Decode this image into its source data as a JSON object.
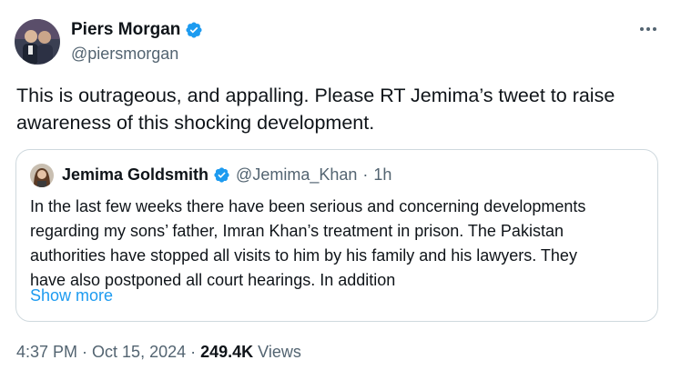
{
  "author": {
    "name": "Piers Morgan",
    "handle": "@piersmorgan"
  },
  "body_text": "This is outrageous, and appalling. Please RT Jemima’s tweet to raise awareness of this shocking development.",
  "quoted_tweet": {
    "name": "Jemima Goldsmith",
    "handle": "@Jemima_Khan",
    "separator": "·",
    "time": "1h",
    "text_lines": [
      "In the last few weeks there have been serious and concerning developments",
      "regarding my sons’ father, Imran Khan’s treatment in prison. The Pakistan",
      "authorities have stopped all visits to him by his family and his lawyers. They",
      "have also postponed all court hearings. In addition"
    ],
    "show_more_label": "Show more"
  },
  "meta": {
    "time": "4:37 PM",
    "separator1": "·",
    "date": "Oct 15, 2024",
    "separator2": "·",
    "views_count": "249.4K",
    "views_label": "Views"
  },
  "colors": {
    "verified_blue": "#1d9bf0",
    "link_blue": "#1d9bf0",
    "secondary_text": "#536471",
    "primary_text": "#0f1419",
    "border": "#cfd9de"
  },
  "icons": {
    "verified": "verified-badge-icon",
    "more": "more-options-icon"
  }
}
